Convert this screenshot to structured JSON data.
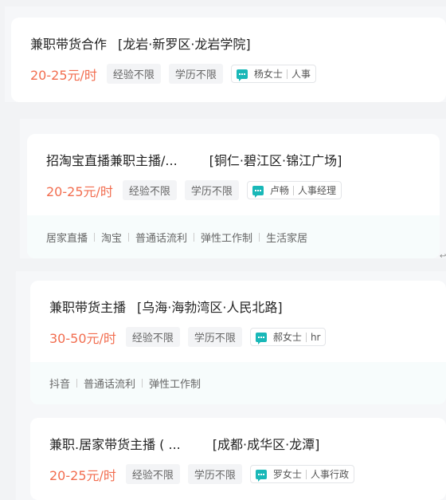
{
  "jobs": [
    {
      "title": "兼职带货合作",
      "location": "[龙岩·新罗区·龙岩学院]",
      "salary": "20-25元/时",
      "experience": "经验不限",
      "education": "学历不限",
      "recruiter_name": "杨女士",
      "recruiter_role": "人事",
      "welfare": []
    },
    {
      "title": "招淘宝直播兼职主播/...",
      "location": "[铜仁·碧江区·锦江广场]",
      "salary": "20-25元/时",
      "experience": "经验不限",
      "education": "学历不限",
      "recruiter_name": "卢畅",
      "recruiter_role": "人事经理",
      "welfare": [
        "居家直播",
        "淘宝",
        "普通话流利",
        "弹性工作制",
        "生活家居"
      ]
    },
    {
      "title": "兼职带货主播",
      "location": "[乌海·海勃湾区·人民北路]",
      "salary": "30-50元/时",
      "experience": "经验不限",
      "education": "学历不限",
      "recruiter_name": "郝女士",
      "recruiter_role": "hr",
      "welfare": [
        "抖音",
        "普通话流利",
        "弹性工作制"
      ]
    },
    {
      "title": "兼职.居家带货主播 ( ...",
      "location": "[成都·成华区·龙潭]",
      "salary": "20-25元/时",
      "experience": "经验不限",
      "education": "学历不限",
      "recruiter_name": "罗女士",
      "recruiter_role": "人事行政",
      "welfare": []
    }
  ],
  "colors": {
    "salary": "#f26d4f",
    "chat_icon": "#19b8b8",
    "welfare_bg": "#f7fcfc"
  },
  "misc": {
    "cursor_glyph": "↩"
  }
}
